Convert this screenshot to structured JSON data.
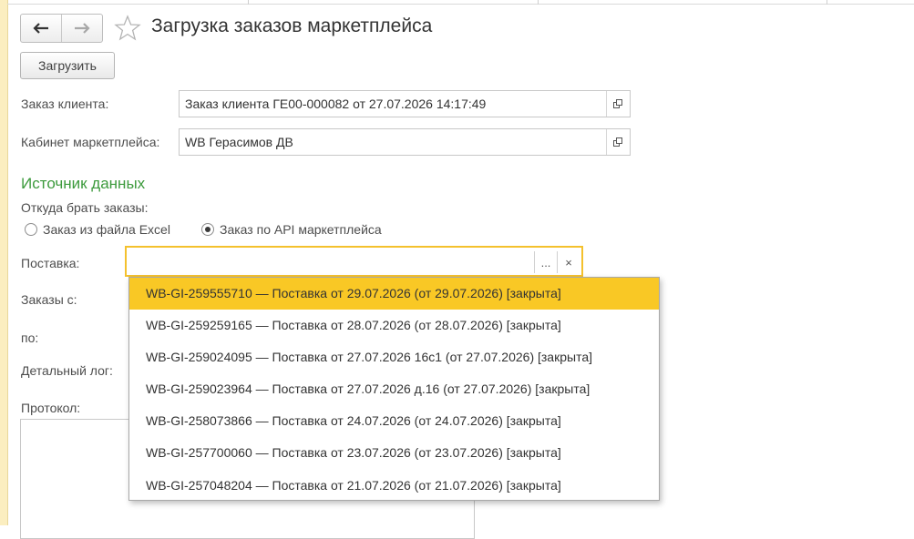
{
  "window": {
    "title": "Загрузка заказов маркетплейса"
  },
  "toolbar": {
    "back_icon": "arrow-left-icon",
    "forward_icon": "arrow-right-icon",
    "favorite_icon": "star-icon",
    "load_label": "Загрузить"
  },
  "form": {
    "order_label": "Заказ клиента:",
    "order_value": "Заказ клиента ГЕ00-000082 от 27.07.2026 14:17:49",
    "cabinet_label": "Кабинет маркетплейса:",
    "cabinet_value": "WB Герасимов ДВ",
    "source_section": "Источник данных",
    "source_question": "Откуда брать заказы:",
    "source_options": [
      {
        "label": "Заказ из файла Excel",
        "selected": false
      },
      {
        "label": "Заказ по API маркетплейса",
        "selected": true
      }
    ],
    "supply_label": "Поставка:",
    "supply_value": "",
    "supply_select_label": "...",
    "supply_clear_label": "×",
    "orders_from_label": "Заказы с:",
    "orders_to_label": "по:",
    "detail_log_label": "Детальный лог:",
    "protocol_label": "Протокол:"
  },
  "dropdown": {
    "items": [
      "WB-GI-259555710 — Поставка от 29.07.2026 (от 29.07.2026) [закрыта]",
      "WB-GI-259259165 — Поставка от 28.07.2026 (от 28.07.2026) [закрыта]",
      "WB-GI-259024095 — Поставка от 27.07.2026 16с1 (от 27.07.2026) [закрыта]",
      "WB-GI-259023964 — Поставка от 27.07.2026 д.16 (от 27.07.2026) [закрыта]",
      "WB-GI-258073866 — Поставка от 24.07.2026 (от 24.07.2026) [закрыта]",
      "WB-GI-257700060 — Поставка от 23.07.2026 (от 23.07.2026) [закрыта]",
      "WB-GI-257048204 — Поставка от 21.07.2026 (от 21.07.2026) [закрыта]"
    ],
    "selected_index": 0
  },
  "colors": {
    "accent": "#f9c825",
    "section": "#3c9a3c",
    "focus_border": "#f4c12d"
  }
}
